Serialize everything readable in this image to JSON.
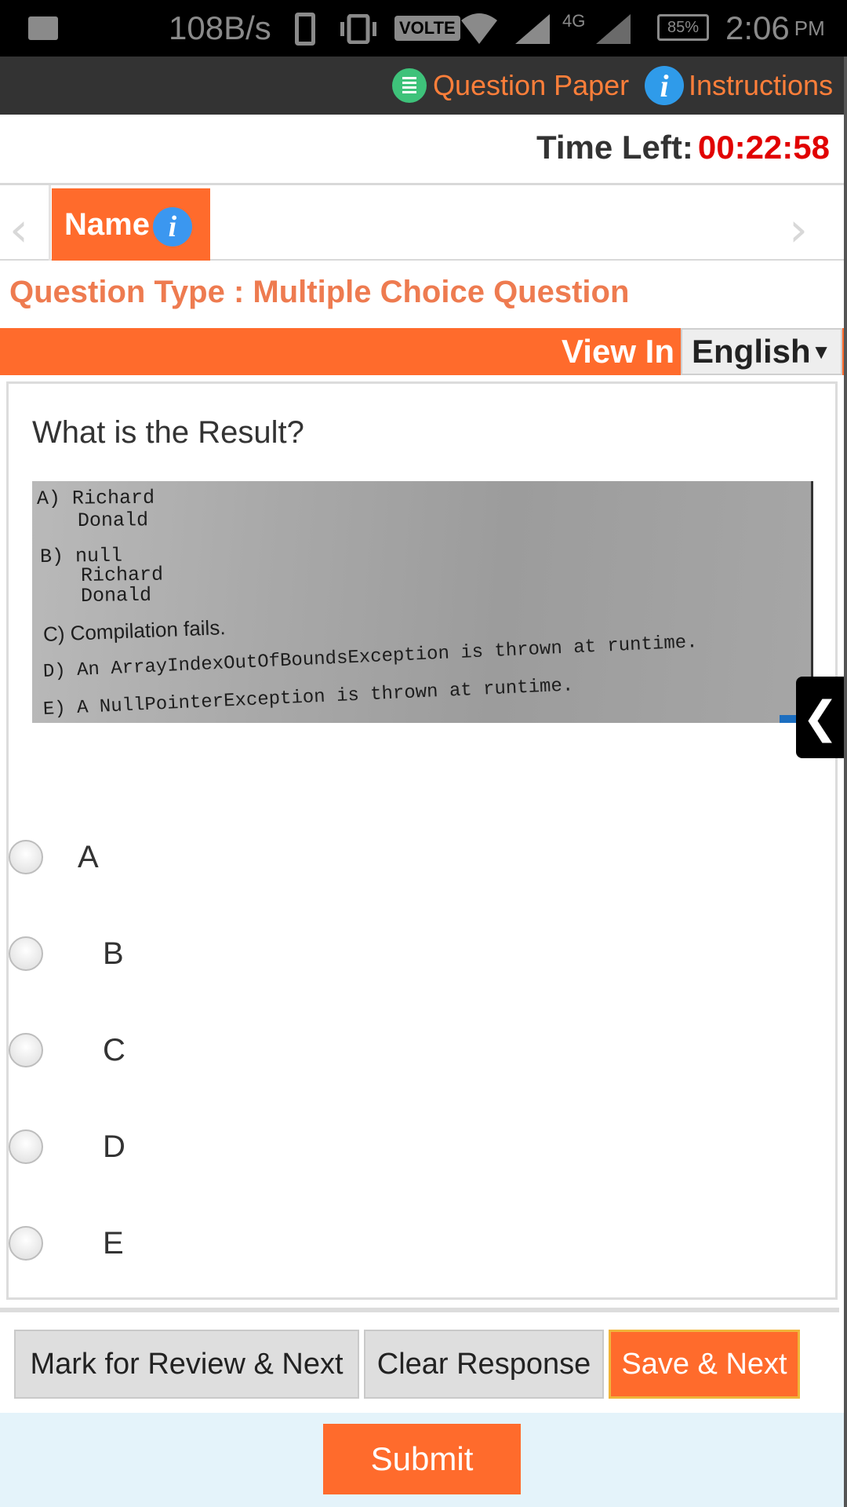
{
  "status_bar": {
    "speed": "108B/s",
    "volte": "VOLTE",
    "network": "4G",
    "battery": "85%",
    "time": "2:06",
    "ampm": "PM",
    "icons": [
      "gallery-icon",
      "phone-icon",
      "vibrate-icon",
      "wifi-icon",
      "signal-icon",
      "battery-icon"
    ]
  },
  "top_nav": {
    "question_paper": "Question Paper",
    "instructions": "Instructions",
    "instructions_icon_glyph": "i"
  },
  "timer": {
    "label": "Time Left:",
    "value": "00:22:58",
    "value_color": "#e10000"
  },
  "section_tabs": {
    "active": "Name",
    "info_glyph": "i",
    "prev_glyph": "‹",
    "next_glyph": "›"
  },
  "question_type": "Question Type : Multiple Choice Question",
  "view_in": {
    "label": "View In",
    "language": "English",
    "caret": "▼"
  },
  "question": {
    "text": "What is the Result?",
    "image_lines": [
      "A) Richard",
      "Donald",
      "B) null",
      "Richard",
      "Donald",
      "C) Compilation fails.",
      "D) An ArrayIndexOutOfBoundsException is thrown at runtime.",
      "E) A NullPointerException is thrown at runtime."
    ],
    "options": [
      "A",
      "B",
      "C",
      "D",
      "E"
    ]
  },
  "side_toggle_glyph": "❮",
  "buttons": {
    "mark_review": "Mark for Review & Next",
    "clear": "Clear Response",
    "save_next": "Save & Next",
    "submit": "Submit"
  },
  "colors": {
    "accent_orange": "#ff6b2c",
    "nav_bg": "#333333",
    "link_orange": "#ff7f3a",
    "info_blue": "#2f9bea",
    "question_paper_green": "#3ec27a",
    "submit_bg": "#e4f3fa"
  }
}
